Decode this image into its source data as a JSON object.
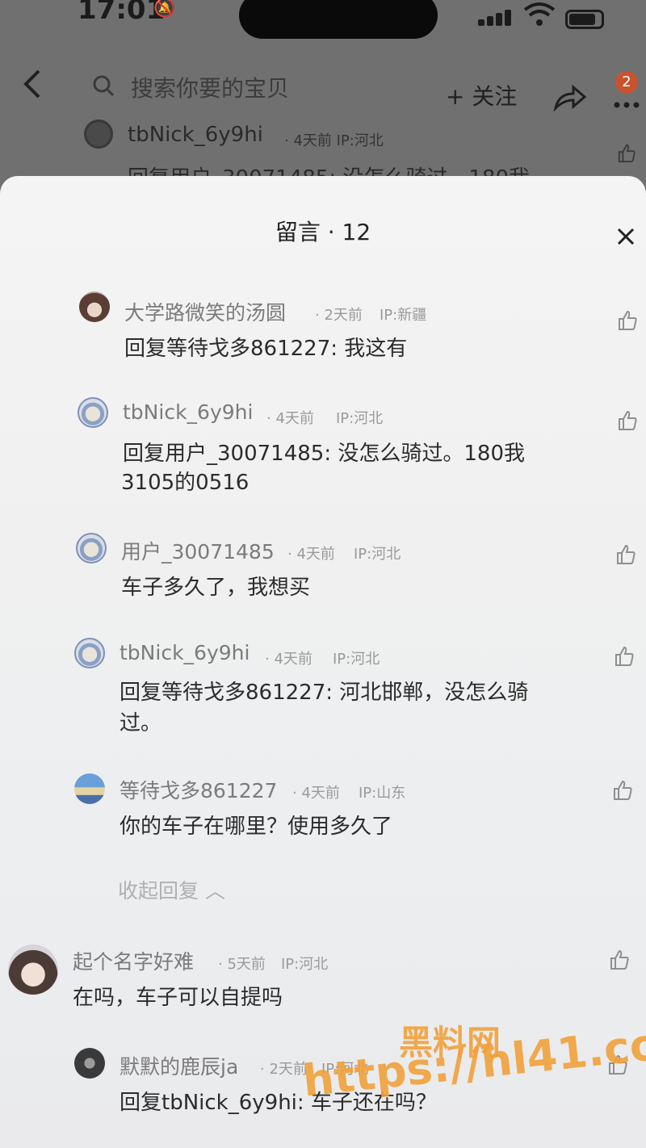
{
  "status": {
    "time": "17:01"
  },
  "bg_header": {
    "search_placeholder": "搜索你要的宝贝",
    "follow_label": "+ 关注",
    "badge": "2"
  },
  "bg_comment": {
    "name": "tbNick_6y9hi",
    "meta": "· 4天前  IP:河北",
    "text": "回复用户_30071485:    没怎么骑过。180我"
  },
  "sheet": {
    "title": "留言 · 12"
  },
  "comments": [
    {
      "name": "大学路微笑的汤圆",
      "time": "· 2天前",
      "ip": "IP:新疆",
      "text": "回复等待戈多861227: 我这有"
    },
    {
      "name": "tbNick_6y9hi",
      "time": "· 4天前",
      "ip": "IP:河北",
      "text": "回复用户_30071485:     没怎么骑过。180我",
      "text2": "3105的0516"
    },
    {
      "name": "用户_30071485",
      "time": "· 4天前",
      "ip": "IP:河北",
      "text": "车子多久了，我想买"
    },
    {
      "name": "tbNick_6y9hi",
      "time": "· 4天前",
      "ip": "IP:河北",
      "text": "回复等待戈多861227:     河北邯郸，没怎么骑",
      "text2": "过。"
    },
    {
      "name": "等待戈多861227",
      "time": "· 4天前",
      "ip": "IP:山东",
      "text": "你的车子在哪里？使用多久了"
    },
    {
      "name": "起个名字好难",
      "time": "· 5天前",
      "ip": "IP:河北",
      "text": "在吗，车子可以自提吗"
    },
    {
      "name": "默默的鹿辰ja",
      "time": "· 2天前",
      "ip": "IP:河北",
      "text": "回复tbNick_6y9hi: 车子还在吗？"
    }
  ],
  "collapse_label": "收起回复 ︿",
  "watermark": {
    "logo": "黑料网",
    "url": "https://hl41.co"
  }
}
